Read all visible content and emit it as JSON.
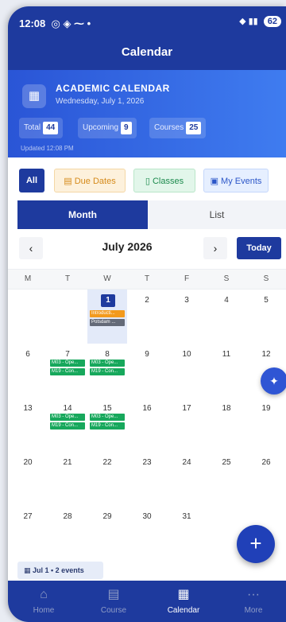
{
  "status": {
    "time": "12:08",
    "battery": "62"
  },
  "header": {
    "title": "Calendar"
  },
  "hero": {
    "title": "ACADEMIC CALENDAR",
    "date": "Wednesday, July 1, 2026",
    "stats": [
      {
        "label": "Total",
        "value": "44"
      },
      {
        "label": "Upcoming",
        "value": "9"
      },
      {
        "label": "Courses",
        "value": "25"
      }
    ],
    "updated": "Updated 12:08 PM"
  },
  "filters": [
    {
      "label": "All",
      "icon": ""
    },
    {
      "label": "Due Dates",
      "icon": "due-icon"
    },
    {
      "label": "Classes",
      "icon": "book-icon"
    },
    {
      "label": "My Events",
      "icon": "user-event-icon"
    }
  ],
  "view_toggle": {
    "month": "Month",
    "list": "List"
  },
  "month_nav": {
    "title": "July 2026",
    "prev": "‹",
    "next": "›",
    "today": "Today"
  },
  "weekdays": [
    "M",
    "T",
    "W",
    "T",
    "F",
    "S",
    "S"
  ],
  "days": [
    {
      "num": "",
      "events": []
    },
    {
      "num": "",
      "events": []
    },
    {
      "num": "1",
      "selected": true,
      "events": [
        {
          "text": "Introducti...",
          "color": "orange"
        },
        {
          "text": "Potsdam ...",
          "color": "gray"
        }
      ]
    },
    {
      "num": "2",
      "events": []
    },
    {
      "num": "3",
      "events": []
    },
    {
      "num": "4",
      "events": []
    },
    {
      "num": "5",
      "events": []
    },
    {
      "num": "6",
      "events": []
    },
    {
      "num": "7",
      "events": [
        {
          "text": "M03 - Ope...",
          "color": "green"
        },
        {
          "text": "M19 - Con...",
          "color": "green"
        }
      ]
    },
    {
      "num": "8",
      "events": [
        {
          "text": "M03 - Ope...",
          "color": "green"
        },
        {
          "text": "M19 - Con...",
          "color": "green"
        }
      ]
    },
    {
      "num": "9",
      "events": []
    },
    {
      "num": "10",
      "events": []
    },
    {
      "num": "11",
      "events": []
    },
    {
      "num": "12",
      "events": []
    },
    {
      "num": "13",
      "events": []
    },
    {
      "num": "14",
      "events": [
        {
          "text": "M03 - Ope...",
          "color": "green"
        },
        {
          "text": "M19 - Con...",
          "color": "green"
        }
      ]
    },
    {
      "num": "15",
      "events": [
        {
          "text": "M03 - Ope...",
          "color": "green"
        },
        {
          "text": "M19 - Con...",
          "color": "green"
        }
      ]
    },
    {
      "num": "16",
      "events": []
    },
    {
      "num": "17",
      "events": []
    },
    {
      "num": "18",
      "events": []
    },
    {
      "num": "19",
      "events": []
    },
    {
      "num": "20",
      "events": []
    },
    {
      "num": "21",
      "events": []
    },
    {
      "num": "22",
      "events": []
    },
    {
      "num": "23",
      "events": []
    },
    {
      "num": "24",
      "events": []
    },
    {
      "num": "25",
      "events": []
    },
    {
      "num": "26",
      "events": []
    },
    {
      "num": "27",
      "events": []
    },
    {
      "num": "28",
      "events": []
    },
    {
      "num": "29",
      "events": []
    },
    {
      "num": "30",
      "events": []
    },
    {
      "num": "31",
      "events": []
    }
  ],
  "selection_info": "Jul 1 • 2 events",
  "fab": {
    "add": "+",
    "assistant": "✦"
  },
  "bottom_nav": [
    {
      "label": "Home",
      "icon": "home-icon",
      "active": false
    },
    {
      "label": "Course",
      "icon": "book-icon",
      "active": false
    },
    {
      "label": "Calendar",
      "icon": "calendar-icon",
      "active": true
    },
    {
      "label": "More",
      "icon": "more-icon",
      "active": false
    }
  ]
}
